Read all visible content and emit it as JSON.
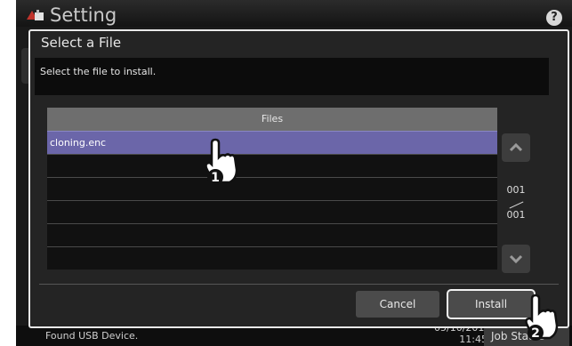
{
  "header": {
    "title": "Setting",
    "help_label": "?"
  },
  "dialog": {
    "title": "Select a File",
    "message": "Select the file to install.",
    "table_header": "Files",
    "files": [
      "cloning.enc",
      "",
      "",
      "",
      "",
      ""
    ],
    "page_current": "001",
    "page_total": "001",
    "cancel_label": "Cancel",
    "install_label": "Install"
  },
  "steps": {
    "first": "1",
    "second": "2"
  },
  "status": {
    "text": "Found USB Device.",
    "date": "05/10/2016",
    "time": "11:45",
    "job_status_label": "Job Status"
  },
  "colors": {
    "selected_row": "#6b66a9",
    "header_row": "#6e6e6e"
  }
}
